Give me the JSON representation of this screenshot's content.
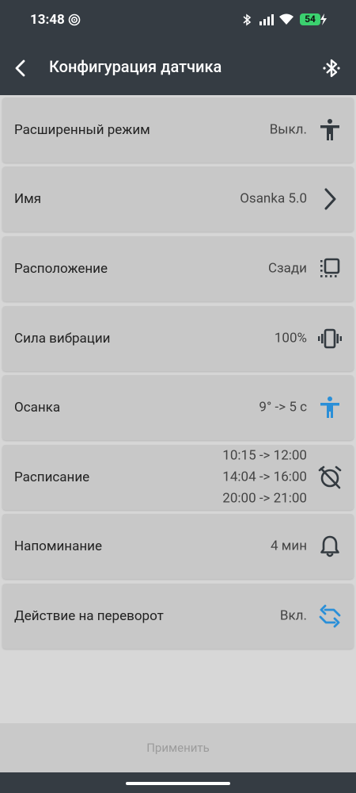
{
  "status": {
    "time": "13:48",
    "battery": "54"
  },
  "appbar": {
    "title": "Конфигурация датчика"
  },
  "rows": [
    {
      "label": "Расширенный режим",
      "value": "Выкл.",
      "icon": "person-icon"
    },
    {
      "label": "Имя",
      "value": "Osanka 5.0",
      "icon": "chevron-right-icon"
    },
    {
      "label": "Расположение",
      "value": "Сзади",
      "icon": "position-icon"
    },
    {
      "label": "Сила вибрации",
      "value": "100%",
      "icon": "vibration-icon"
    },
    {
      "label": "Осанка",
      "value": "9° -> 5 с",
      "icon": "posture-icon"
    },
    {
      "label": "Расписание",
      "values": [
        "10:15 -> 12:00",
        "14:04 -> 16:00",
        "20:00 -> 21:00"
      ],
      "icon": "alarm-off-icon"
    },
    {
      "label": "Напоминание",
      "value": "4 мин",
      "icon": "bell-icon"
    },
    {
      "label": "Действие на переворот",
      "value": "Вкл.",
      "icon": "flip-icon"
    }
  ],
  "apply_label": "Применить",
  "colors": {
    "bar": "#353c43",
    "row": "#c8c8c8",
    "accent": "#2a8fd8",
    "icon": "#333a40",
    "battery": "#3bd16f"
  }
}
